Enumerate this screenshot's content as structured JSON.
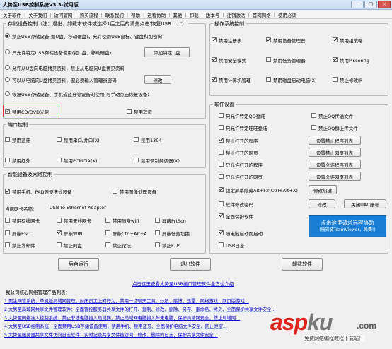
{
  "window": {
    "title": "大势至USB控制系统V3.3-试用版",
    "min": "-",
    "max": "□",
    "close": "×"
  },
  "menu": [
    "关于软件",
    "关于我们",
    "访问官网",
    "购买流程",
    "联系我们",
    "帮助",
    "远程协助",
    "其他",
    "卸载",
    "版本号",
    "注销激活",
    "首网网络",
    "使用必读"
  ],
  "storage": {
    "legend": "存储设备控制（注：退出、卸载本软件或选择1后之后的请先点击'恢复USB......'）",
    "options": [
      {
        "label": "禁止USB存储设备(如U盘、移动硬盘)，允许使用USB鼠标、键盘和加密狗",
        "checked": true
      },
      {
        "label": "只允许特定USB存储设备使用(如U盘、移动硬盘)",
        "checked": false
      },
      {
        "label": "允许从U盘向电脑拷贝资料，禁止从电脑向U盘拷贝资料",
        "checked": false
      },
      {
        "label": "可以从电脑向U盘拷贝资料，但必须输入管理员密码",
        "checked": false
      },
      {
        "label": "恢复USB存储设备、手机或蓝牙等设备的使用(可手动点击恢复设备)",
        "checked": false
      }
    ],
    "add_button": "添加特定U盘",
    "modify_button": "修改"
  },
  "cdrom": {
    "disable_cd": "禁用CD/DVD光驱",
    "disable_floppy": "禁用软驱"
  },
  "ports": {
    "legend": "端口控制",
    "items": [
      "禁用蓝牙",
      "禁用串口/并口(X)",
      "禁用1394",
      "禁用红外",
      "禁用PCMCIA(X)",
      "禁用调制解调器(X)"
    ]
  },
  "smart": {
    "legend": "智能设备及网络控制",
    "items": [
      {
        "label": "禁用手机、PAD等便携式设备",
        "checked": true
      },
      {
        "label": "禁用图像处理设备",
        "checked": false
      }
    ],
    "nic_label": "当前网卡名称:",
    "nic_value": "USB to Ethernet Adapter",
    "nic_items": [
      {
        "label": "禁用有线网卡",
        "checked": false
      },
      {
        "label": "禁用无线网卡",
        "checked": false
      },
      {
        "label": "禁用随身wifi",
        "checked": false
      },
      {
        "label": "屏蔽PrtScn",
        "checked": false
      },
      {
        "label": "屏蔽ESC",
        "checked": false
      },
      {
        "label": "屏蔽WIN",
        "checked": true
      },
      {
        "label": "屏蔽Ctrl+Alt+A",
        "checked": false
      },
      {
        "label": "屏蔽任务切换",
        "checked": false
      },
      {
        "label": "禁止发邮件",
        "checked": false
      },
      {
        "label": "禁止网盘",
        "checked": false
      },
      {
        "label": "禁止论坛",
        "checked": false
      },
      {
        "label": "禁止FTP",
        "checked": false
      }
    ]
  },
  "os": {
    "legend": "操作系统控制",
    "items": [
      {
        "label": "禁用注册表",
        "checked": true
      },
      {
        "label": "禁用设备管理器",
        "checked": true
      },
      {
        "label": "禁用组策略",
        "checked": true
      },
      {
        "label": "禁用安全模式",
        "checked": true
      },
      {
        "label": "禁用任务管理器",
        "checked": false
      },
      {
        "label": "禁用Msconfig",
        "checked": true
      },
      {
        "label": "禁用计算机管理",
        "checked": true
      },
      {
        "label": "禁用磁盘启动电脑(X)",
        "checked": false
      },
      {
        "label": "禁止修改IP",
        "checked": false
      }
    ]
  },
  "software": {
    "legend": "软件设置",
    "left": [
      {
        "label": "只允许特定QQ登陆",
        "checked": false
      },
      {
        "label": "只允许特定旺旺登陆",
        "checked": false
      },
      {
        "label": "禁止打开的程序",
        "checked": true
      },
      {
        "label": "禁止打开的网页",
        "checked": false
      },
      {
        "label": "只允许打开的程序",
        "checked": false
      },
      {
        "label": "只允许打开的网页",
        "checked": false
      },
      {
        "label": "锁定屏幕隐藏Alt+F2(Ctrl+Alt+X)",
        "checked": true
      },
      {
        "label": "软件修改密码",
        "checked": false
      },
      {
        "label": "全面保护软件",
        "checked": true
      },
      {
        "label": "随电脑启动而启动",
        "checked": true
      },
      {
        "label": "USB日志",
        "checked": false
      }
    ],
    "right_checks": [
      {
        "label": "禁止QQ传送文件",
        "checked": false
      },
      {
        "label": "禁止QQ群上传文件",
        "checked": false
      }
    ],
    "buttons": [
      "设置禁止程序列表",
      "设置禁止网页列表",
      "设置允许程序列表",
      "设置允许网页列表",
      "修改热键",
      "修改",
      "关闭UAC账号"
    ]
  },
  "remote": {
    "line1": "点击这里请求远程协助",
    "line2": "(需安装TeamViewer，免费!)"
  },
  "bottom_buttons": {
    "run": "后台运行",
    "exit": "退出软件",
    "uninstall": "卸载软件"
  },
  "promo_link": "点击这里查看大势至USB接口管理软件全方位介绍",
  "products": {
    "title": "我公司核心网络管理产品列表：",
    "items": [
      "1.聚生网管系统：单机版局域网管理，封闭员工上网行为，禁用一切聊天工具、炒股、赌博、迅雷、网络游戏、网页版游戏...",
      "2.大势至局域网共享文件管理软件：全面管控服务器共享文件的打开、复制、修改、删除、另存、重命名、拷贝、全面保护共享文件安全...",
      "3.大势至网络准入控制系统：禁止非法电脑接入局域网，禁止局域网电脑接入外来电脑，保护局域网安全，防止局域网...",
      "4.大势至USB控制系统：全面禁用USB存储设备使用，禁用手机、禁用蓝牙、全面保护电脑文件安全、防止泄密...",
      "5.大势至服务器共享文件访问日志软件：实时记录共享文件被访问、修改、删除的日志，保护共享文件安全..."
    ]
  },
  "watermark": {
    "logo_a": "asp",
    "logo_b": "ku",
    "logo_c": ".com",
    "sub": "免费网络编程教程下载站！"
  }
}
